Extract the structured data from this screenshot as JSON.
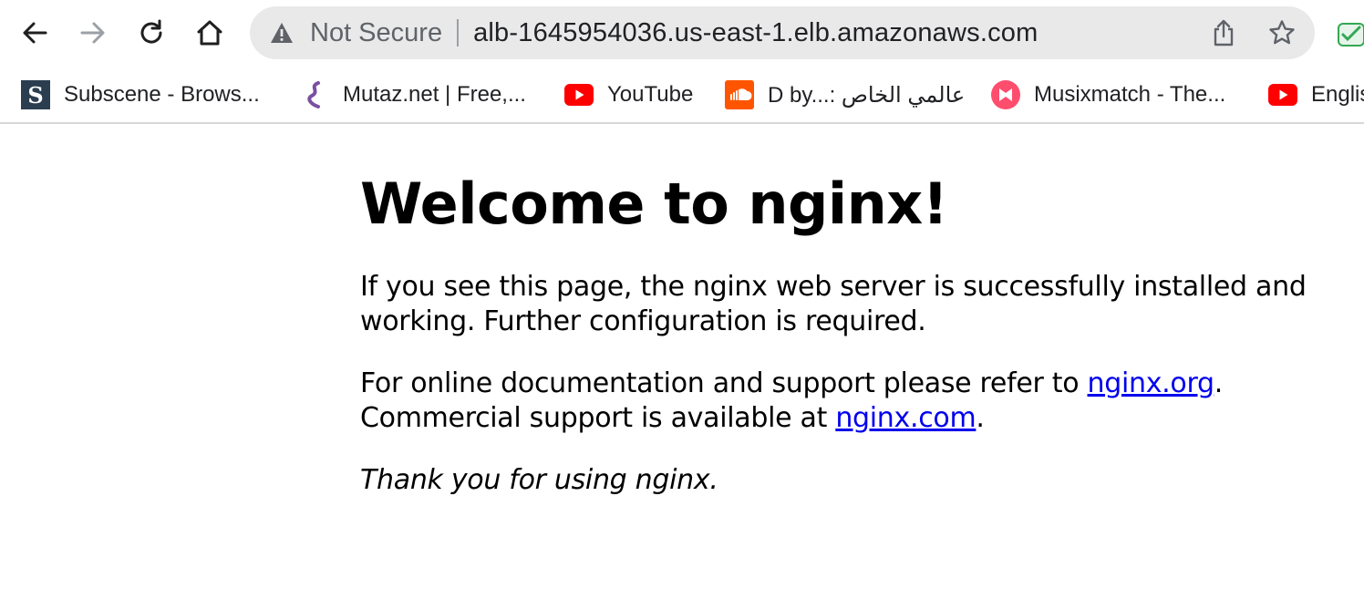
{
  "toolbar": {
    "back_icon": "arrow-left-icon",
    "forward_icon": "arrow-right-icon",
    "reload_icon": "reload-icon",
    "home_icon": "home-icon",
    "security_icon": "warning-triangle-icon",
    "security_label": "Not Secure",
    "url": "alb-1645954036.us-east-1.elb.amazonaws.com",
    "share_icon": "share-icon",
    "bookmark_icon": "star-icon",
    "extension_icon": "extension-icon"
  },
  "bookmarks": [
    {
      "label": "Subscene - Brows...",
      "icon": "subscene-icon"
    },
    {
      "label": "Mutaz.net | Free,...",
      "icon": "mutaz-icon"
    },
    {
      "label": "YouTube",
      "icon": "youtube-icon"
    },
    {
      "label": "D by...: عالمي الخاص",
      "icon": "soundcloud-icon"
    },
    {
      "label": "Musixmatch - The...",
      "icon": "musixmatch-icon"
    },
    {
      "label": "English",
      "icon": "youtube-icon"
    }
  ],
  "page": {
    "heading": "Welcome to nginx!",
    "para1": "If you see this page, the nginx web server is successfully installed and working. Further configuration is required.",
    "para2_prefix": "For online documentation and support please refer to ",
    "link_org": "nginx.org",
    "para2_mid": ".",
    "para2_line2_prefix": "Commercial support is available at ",
    "link_com": "nginx.com",
    "para2_suffix": ".",
    "para3": "Thank you for using nginx."
  },
  "colors": {
    "link": "#0000ee",
    "omnibox_bg": "#e9e9ea",
    "youtube_red": "#ff0000",
    "soundcloud_orange": "#ff5500",
    "musixmatch_pink": "#ff4d6d"
  }
}
